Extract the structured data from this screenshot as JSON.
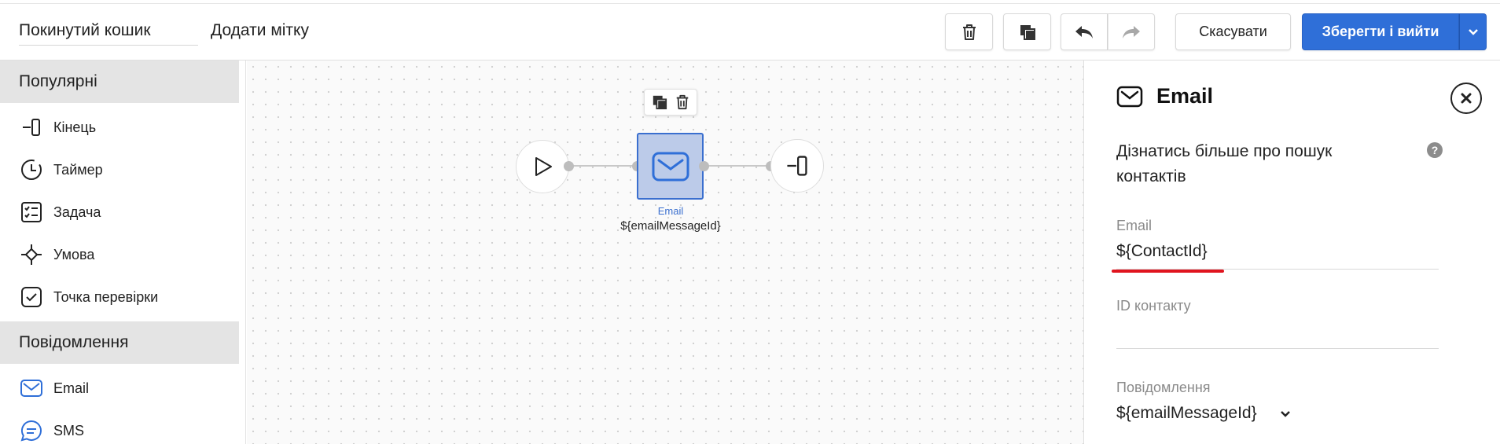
{
  "topbar": {
    "flow_name": "Покинутий кошик",
    "add_label": "Додати мітку",
    "cancel_label": "Скасувати",
    "save_label": "Зберегти і вийти"
  },
  "sidebar": {
    "sections": [
      {
        "title": "Популярні",
        "items": [
          {
            "label": "Кінець",
            "icon": "end-icon"
          },
          {
            "label": "Таймер",
            "icon": "timer-icon"
          },
          {
            "label": "Задача",
            "icon": "task-icon"
          },
          {
            "label": "Умова",
            "icon": "condition-icon"
          },
          {
            "label": "Точка перевірки",
            "icon": "checkpoint-icon"
          }
        ]
      },
      {
        "title": "Повідомлення",
        "items": [
          {
            "label": "Email",
            "icon": "email-icon"
          },
          {
            "label": "SMS",
            "icon": "sms-icon"
          }
        ]
      }
    ]
  },
  "canvas": {
    "email_node": {
      "caption": "Email",
      "message_ref": "${emailMessageId}"
    }
  },
  "panel": {
    "title": "Email",
    "learn_more": "Дізнатись більше про пошук контактів",
    "help_glyph": "?",
    "fields": [
      {
        "label": "Email",
        "value": "${ContactId}"
      },
      {
        "label": "ID контакту",
        "value": ""
      },
      {
        "label": "Повідомлення",
        "value": "${emailMessageId}"
      }
    ]
  },
  "colors": {
    "accent": "#2f6fd8",
    "node_selected_fill": "#bccbe9",
    "node_selected_border": "#3a6fcf",
    "highlight_underline": "#e0141e",
    "section_header_bg": "#e4e4e4"
  }
}
